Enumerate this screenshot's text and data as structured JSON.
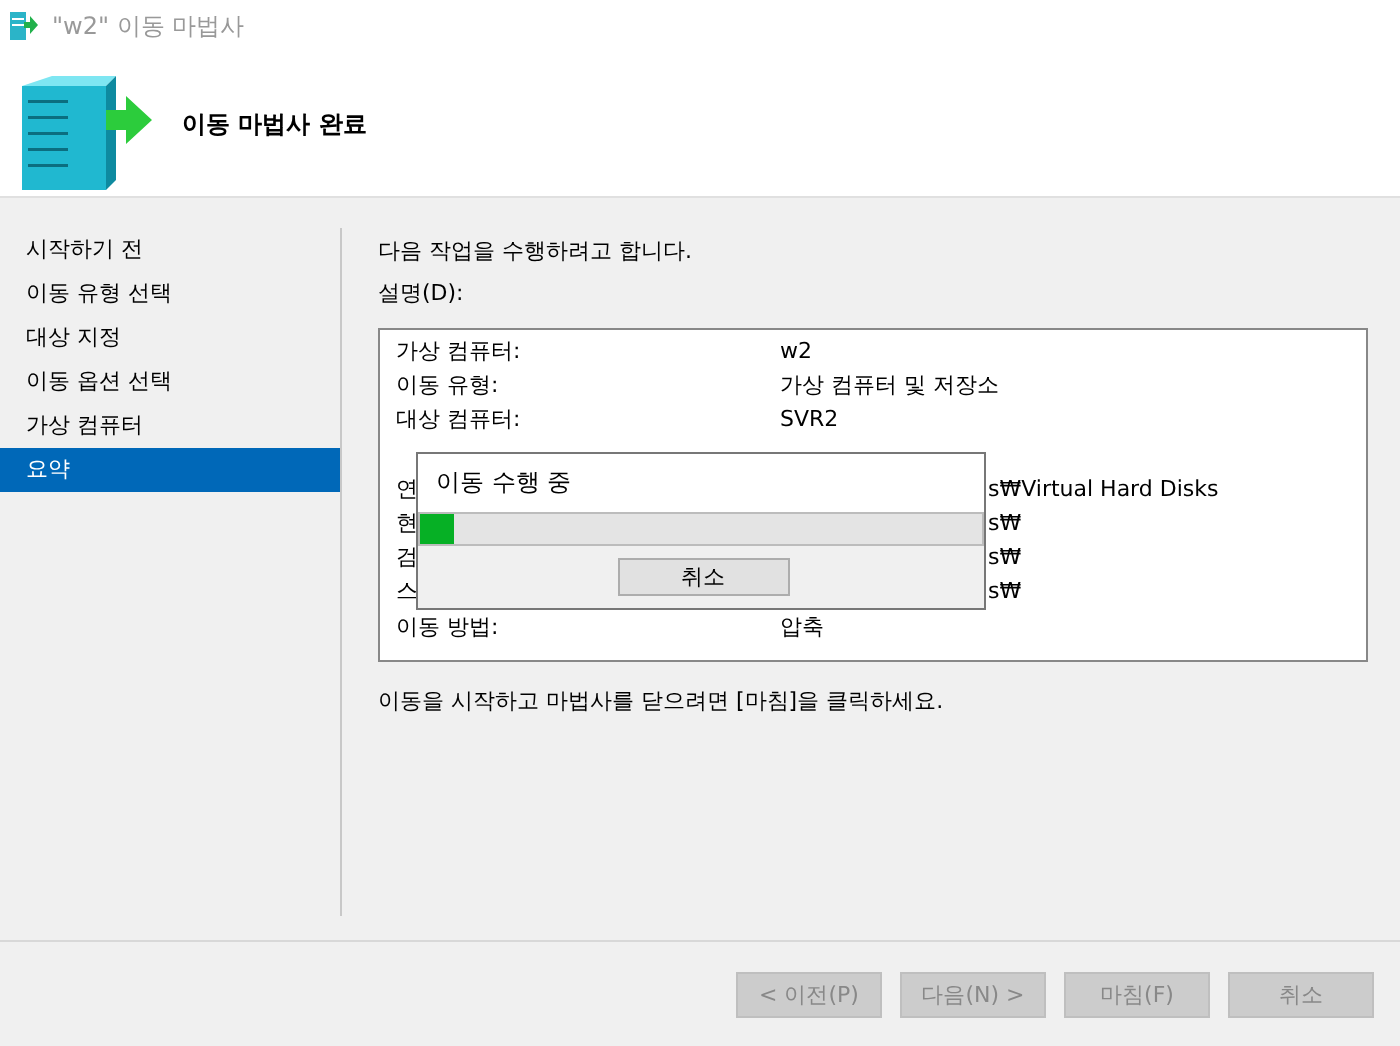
{
  "window": {
    "title": "\"w2\" 이동 마법사"
  },
  "header": {
    "title": "이동 마법사 완료"
  },
  "sidebar": {
    "items": [
      {
        "label": "시작하기 전",
        "selected": false
      },
      {
        "label": "이동 유형 선택",
        "selected": false
      },
      {
        "label": "대상 지정",
        "selected": false
      },
      {
        "label": "이동 옵션 선택",
        "selected": false
      },
      {
        "label": "가상 컴퓨터",
        "selected": false
      },
      {
        "label": "요약",
        "selected": true
      }
    ]
  },
  "intro": "다음 작업을 수행하려고 합니다.",
  "description_label": "설명(D):",
  "details": [
    {
      "kind": "full",
      "label": "가상 컴퓨터:",
      "value": "w2"
    },
    {
      "kind": "full",
      "label": "이동 유형:",
      "value": "가상 컴퓨터 및 저장소"
    },
    {
      "kind": "full",
      "label": "대상 컴퓨터:",
      "value": "SVR2"
    },
    {
      "kind": "hidden"
    },
    {
      "kind": "covered",
      "label": "연",
      "value": "s₩Virtual Hard Disks"
    },
    {
      "kind": "covered",
      "label": "현",
      "value": "s₩"
    },
    {
      "kind": "covered",
      "label": "검",
      "value": "s₩"
    },
    {
      "kind": "covered",
      "label": "스",
      "value": "s₩"
    },
    {
      "kind": "full",
      "label": "이동 방법:",
      "value": "압축"
    }
  ],
  "progress_dialog": {
    "title": "이동 수행 중",
    "level": 0.06,
    "cancel": "취소"
  },
  "footer_note": "이동을 시작하고 마법사를 닫으려면 [마침]을 클릭하세요.",
  "buttons": [
    {
      "label": "< 이전(P)",
      "disabled": true
    },
    {
      "label": "다음(N) >",
      "disabled": true
    },
    {
      "label": "마침(F)",
      "disabled": true
    },
    {
      "label": "취소",
      "disabled": true
    }
  ]
}
